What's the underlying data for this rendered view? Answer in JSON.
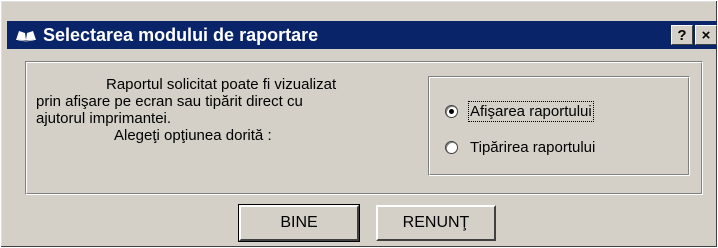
{
  "dialog": {
    "title": "Selectarea modului de raportare",
    "title_icon": "reading-book-icon",
    "help_button": "?",
    "close_button": "×"
  },
  "message": {
    "line1": "Raportul solicitat poate fi vizualizat",
    "line2": "prin afişare pe ecran sau tipărit direct cu",
    "line3": "ajutorul imprimantei.",
    "line4": "Alegeţi opţiunea dorită :"
  },
  "options": [
    {
      "label": "Afişarea raportului",
      "checked": true
    },
    {
      "label": "Tipărirea raportului",
      "checked": false
    }
  ],
  "buttons": {
    "ok": "BINE",
    "cancel": "RENUNŢ"
  },
  "colors": {
    "titlebar": "#0a246a",
    "face": "#d4d0c8"
  }
}
